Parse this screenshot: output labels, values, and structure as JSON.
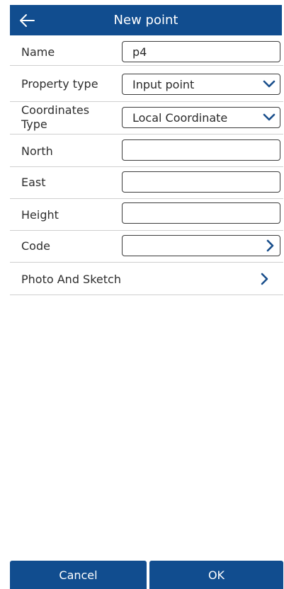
{
  "header": {
    "title": "New point",
    "back_icon": "arrow-left-icon"
  },
  "form": {
    "name": {
      "label": "Name",
      "value": "p4"
    },
    "property_type": {
      "label": "Property type",
      "value": "Input point",
      "icon": "chevron-down-icon"
    },
    "coordinates_type": {
      "label": "Coordinates Type",
      "value": "Local Coordinate",
      "icon": "chevron-down-icon"
    },
    "north": {
      "label": "North",
      "value": ""
    },
    "east": {
      "label": "East",
      "value": ""
    },
    "height": {
      "label": "Height",
      "value": ""
    },
    "code": {
      "label": "Code",
      "value": "",
      "icon": "chevron-right-icon"
    },
    "photo_sketch": {
      "label": "Photo And Sketch",
      "icon": "chevron-right-icon"
    }
  },
  "footer": {
    "cancel_label": "Cancel",
    "ok_label": "OK"
  },
  "colors": {
    "primary": "#114d8f",
    "accent": "#1a4f8c",
    "divider": "#cfcfcf"
  }
}
